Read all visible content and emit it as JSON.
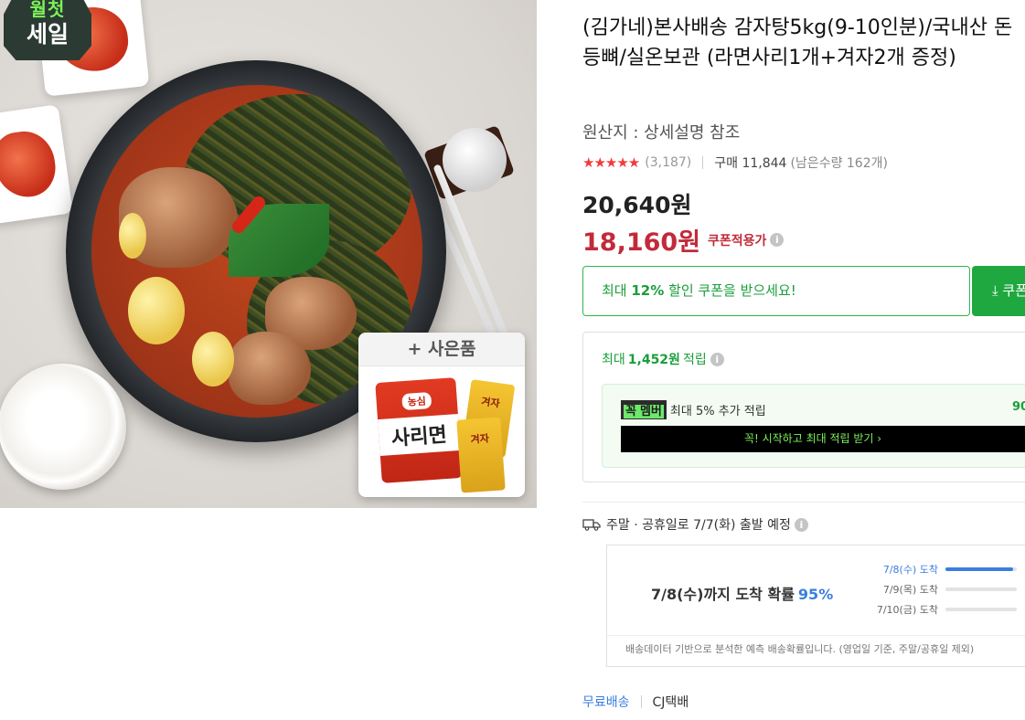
{
  "badge": {
    "line1": "월첫",
    "line2": "세일"
  },
  "gift": {
    "label": "+ 사은품",
    "ramen_brand": "농심",
    "ramen_name": "사리면",
    "mustard_label": "겨자"
  },
  "product": {
    "title": "(김가네)본사배송 감자탕5kg(9-10인분)/국내산 돈등뼈/실온보관 (라면사리1개+겨자2개 증정)",
    "origin": "원산지 : 상세설명 참조",
    "stars": "★★★★★",
    "rating_count": "(3,187)",
    "purchase": "구매 11,844",
    "remain": "(남은수량 162개)",
    "price_original": "20,640원",
    "price_sale": "18,160원",
    "coupon_note": "쿠폰적용가"
  },
  "coupon": {
    "text_prefix": "최대 ",
    "text_bold": "12%",
    "text_suffix": " 할인 쿠폰을 받으세요!",
    "button_label": "⤓ 쿠폰"
  },
  "points": {
    "prefix": "최대 ",
    "amount": "1,452원",
    "suffix": " 적립",
    "member_logo": "꼭",
    "member_logo2": "멤버",
    "member_text": "최대 5% 추가 적립",
    "member_amount": "90",
    "member_button": "꼭! 시작하고 최대 적립 받기 ›"
  },
  "shipping": {
    "notice": "주말 · 공휴일로 7/7(화) 출발 예정",
    "arrival_text": "7/8(수)까지 도착 확률",
    "arrival_pct": "95%",
    "rows": [
      {
        "label": "7/8(수) 도착",
        "fill": 0.95
      },
      {
        "label": "7/9(목) 도착",
        "fill": 0
      },
      {
        "label": "7/10(금) 도착",
        "fill": 0
      }
    ],
    "footnote": "배송데이터 기반으로 분석한 예측 배송확률입니다. (영업일 기준, 주말/공휴일 제외)",
    "free": "무료배송",
    "courier": "CJ택배"
  },
  "colors": {
    "sale_red": "#c22a3a",
    "coupon_green": "#1fa83f",
    "accent_blue": "#3a7ee0"
  }
}
